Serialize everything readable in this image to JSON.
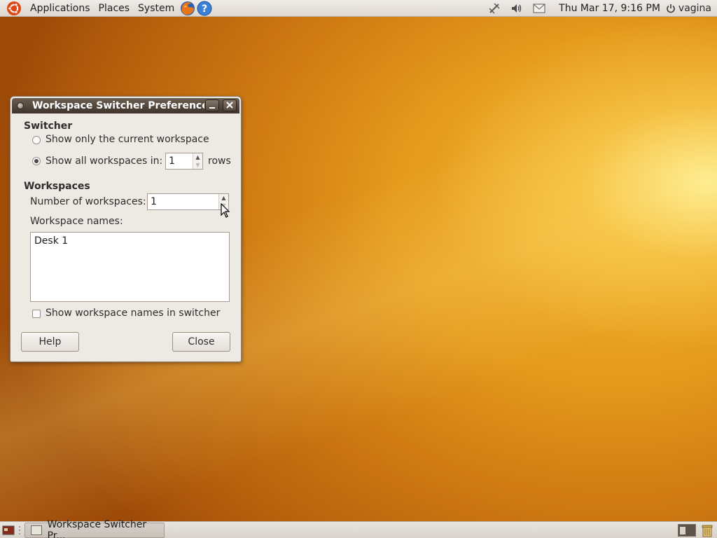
{
  "top_panel": {
    "menus": [
      "Applications",
      "Places",
      "System"
    ],
    "launchers": [
      "firefox-icon",
      "help-icon"
    ],
    "tray": [
      "network-icon",
      "volume-icon",
      "mail-icon"
    ],
    "clock": "Thu Mar 17,  9:16 PM",
    "user": "vagina"
  },
  "dialog": {
    "title": "Workspace Switcher Preferences",
    "switcher_heading": "Switcher",
    "option_current": "Show only the current workspace",
    "option_all": "Show all workspaces in:",
    "rows_value": "1",
    "rows_suffix": "rows",
    "selected_option": "all",
    "workspaces_heading": "Workspaces",
    "num_label": "Number of workspaces:",
    "num_value": "1",
    "names_label": "Workspace names:",
    "names": [
      "Desk 1"
    ],
    "show_names_label": "Show workspace names in switcher",
    "show_names_checked": false,
    "help_button": "Help",
    "close_button": "Close"
  },
  "bottom_panel": {
    "task_label": "Workspace Switcher Pr..."
  },
  "colors": {
    "titlebar": "#4a3f36",
    "dialog_bg": "#ede9e3",
    "desktop_accent": "#e59a1c"
  }
}
